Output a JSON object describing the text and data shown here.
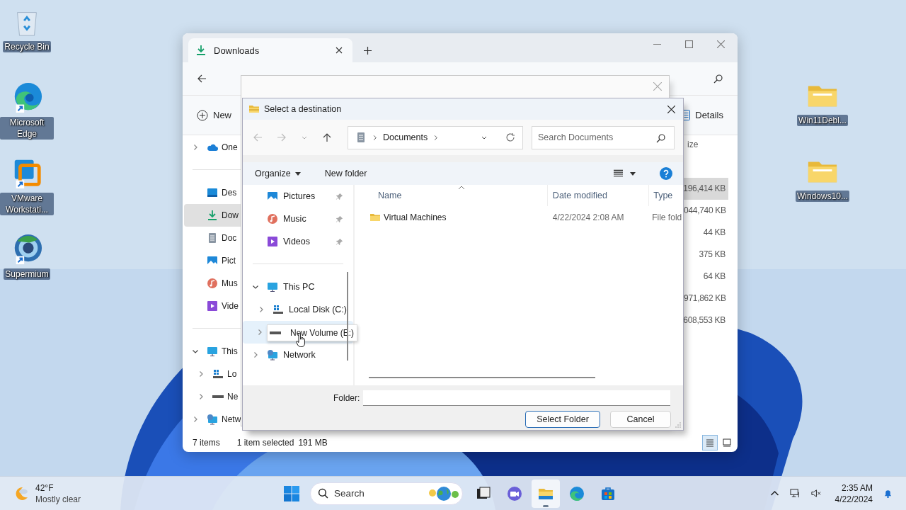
{
  "desktop": {
    "left_icons": [
      {
        "label": "Recycle Bin",
        "kind": "recycle-bin"
      },
      {
        "label": "Microsoft Edge",
        "kind": "edge"
      },
      {
        "label": "VMware Workstati...",
        "kind": "vmware"
      },
      {
        "label": "Supermium",
        "kind": "supermium"
      }
    ],
    "right_icons": [
      {
        "label": "Win11Debl...",
        "kind": "folder"
      },
      {
        "label": "Windows10...",
        "kind": "folder"
      }
    ]
  },
  "explorer": {
    "tabs": [
      {
        "label": "Downloads",
        "selected": true
      }
    ],
    "command_bar": {
      "new": "New",
      "details": "Details"
    },
    "nav_groups": [
      [
        {
          "label": "One",
          "kind": "cloud",
          "expanded": false,
          "selected": false
        }
      ],
      [
        {
          "label": "Des",
          "kind": "desktop",
          "selected": false
        },
        {
          "label": "Dow",
          "kind": "download",
          "selected": true
        },
        {
          "label": "Doc",
          "kind": "document",
          "selected": false
        },
        {
          "label": "Pict",
          "kind": "pictures",
          "selected": false
        },
        {
          "label": "Mus",
          "kind": "music",
          "selected": false
        },
        {
          "label": "Vide",
          "kind": "videos",
          "selected": false
        }
      ],
      [
        {
          "label": "This",
          "kind": "pc",
          "expanded": true,
          "selected": false,
          "children": [
            {
              "label": "Lo",
              "kind": "system-disk",
              "expanded": false,
              "selected": false
            },
            {
              "label": "Ne",
              "kind": "drive",
              "expanded": false,
              "selected": false
            }
          ]
        },
        {
          "label": "Netw",
          "kind": "network",
          "expanded": false,
          "selected": false
        }
      ]
    ],
    "size_column": {
      "header": "ize",
      "cells": [
        {
          "text": "196,414 KB",
          "selected": true
        },
        {
          "text": ",044,740 KB",
          "selected": false
        },
        {
          "text": "44 KB",
          "selected": false
        },
        {
          "text": "375 KB",
          "selected": false
        },
        {
          "text": "64 KB",
          "selected": false
        },
        {
          "text": ",971,862 KB",
          "selected": false
        },
        {
          "text": "608,553 KB",
          "selected": false
        }
      ]
    },
    "status_bar": {
      "item_count": "7 items",
      "selection": "1 item selected",
      "selection_size": "191 MB",
      "views": [
        {
          "kind": "details",
          "selected": true
        },
        {
          "kind": "tiles",
          "selected": false
        }
      ]
    }
  },
  "dialog": {
    "title": "Select a destination",
    "breadcrumb": [
      "Documents"
    ],
    "search_placeholder": "Search Documents",
    "organize": "Organize",
    "new_folder": "New folder",
    "nav_groups": [
      [
        {
          "label": "Pictures",
          "kind": "pictures",
          "pinned": true,
          "selected": false
        },
        {
          "label": "Music",
          "kind": "music",
          "pinned": true,
          "selected": false
        },
        {
          "label": "Videos",
          "kind": "videos",
          "pinned": true,
          "selected": false
        }
      ],
      [
        {
          "label": "This PC",
          "kind": "pc",
          "expanded": true,
          "selected": false,
          "children": [
            {
              "label": "Local Disk (C:)",
              "kind": "system-disk",
              "expanded": false,
              "selected": false
            },
            {
              "label": "New Volume (E:)",
              "kind": "drive",
              "expanded": false,
              "selected": true,
              "tooltip": true
            }
          ]
        },
        {
          "label": "Network",
          "kind": "network",
          "expanded": false,
          "selected": false
        }
      ]
    ],
    "columns": [
      {
        "label": "Name",
        "sorted": true
      },
      {
        "label": "Date modified",
        "sorted": false
      },
      {
        "label": "Type",
        "sorted": false
      }
    ],
    "rows": [
      {
        "name": "Virtual Machines",
        "date": "4/22/2024 2:08 AM",
        "type": "File fold",
        "selected": false
      }
    ],
    "folder_label": "Folder:",
    "buttons": [
      {
        "label": "Select Folder",
        "default": true
      },
      {
        "label": "Cancel",
        "default": false
      }
    ]
  },
  "taskbar": {
    "weather": {
      "temperature": "42°F",
      "condition": "Mostly clear"
    },
    "search": "Search",
    "apps": [
      {
        "kind": "task-view",
        "selected": false
      },
      {
        "kind": "meet",
        "selected": false
      },
      {
        "kind": "explorer",
        "selected": true
      },
      {
        "kind": "edge",
        "selected": false
      },
      {
        "kind": "store",
        "selected": false
      }
    ],
    "clock": {
      "time": "2:35 AM",
      "date": "4/22/2024"
    }
  }
}
